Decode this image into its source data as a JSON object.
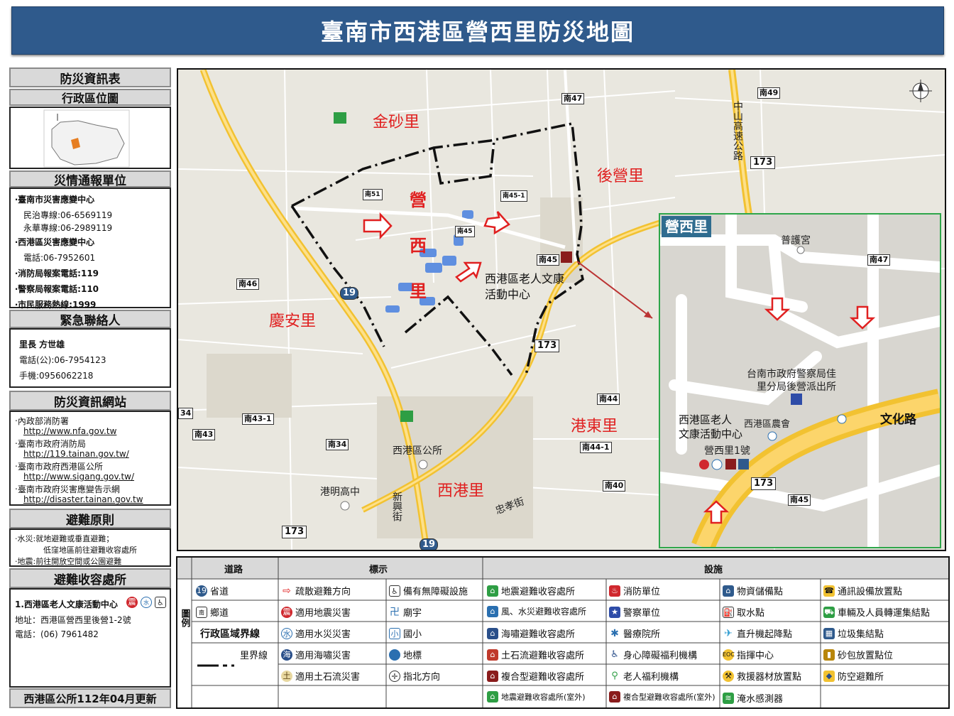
{
  "title": "臺南市西港區營西里防災地圖",
  "side": {
    "info_header": "防災資訊表",
    "location_header": "行政區位圖",
    "report_header": "災情通報單位",
    "report_lines": [
      "‧臺南市災害應變中心",
      "民治專線:06-6569119",
      "永華專線:06-2989119",
      "‧西港區災害應變中心",
      "電話:06-7952601",
      "‧消防局報案電話:119",
      "‧警察局報案電話:110",
      "‧市民服務熱線:1999"
    ],
    "contact_header": "緊急聯絡人",
    "contact_lines": [
      "里長 方世雄",
      "電話(公):06-7954123",
      "手機:0956062218"
    ],
    "web_header": "防災資訊網站",
    "web_lines": [
      {
        "name": "‧內政部消防署",
        "url": "http://www.nfa.gov.tw"
      },
      {
        "name": "‧臺南市政府消防局",
        "url": "http://119.tainan.gov.tw/"
      },
      {
        "name": "‧臺南市政府西港區公所",
        "url": "http://www.sigang.gov.tw/"
      },
      {
        "name": "‧臺南市政府災害應變告示網",
        "url": "http://disaster.tainan.gov.tw"
      }
    ],
    "principle_header": "避難原則",
    "principle_lines": [
      "‧水災:就地避難或垂直避難；",
      "低窪地區前往避難收容處所",
      "‧地震:前往開放空間或公園避難"
    ],
    "shelter_header": "避難收容處所",
    "shelter_name": "1.西港區老人文康活動中心",
    "shelter_addr": "地址：西港區營西里後營1-2號",
    "shelter_tel": "電話：(06) 7961482",
    "footer": "西港區公所112年04月更新"
  },
  "map": {
    "villages": [
      "金砂里",
      "後營里",
      "慶安里",
      "港東里",
      "西港里"
    ],
    "center_village_chars": [
      "營",
      "西",
      "里"
    ],
    "places": [
      "西港區老人文康活動中心",
      "西港區公所",
      "港明高中",
      "新興街",
      "忠孝街",
      "中山高速公路"
    ],
    "roads": [
      "南47",
      "南49",
      "173",
      "南51",
      "南45",
      "南45-1",
      "南46",
      "19",
      "南44",
      "南43-1",
      "南43",
      "南34",
      "南44-1",
      "南40",
      "34"
    ],
    "inset": {
      "title": "營西里",
      "labels": [
        "普護宮",
        "南47",
        "台南市政府警察局佳",
        "里分局後營派出所",
        "西港區老人",
        "文康活動中心",
        "西港區農會",
        "營西里1號",
        "文化路",
        "173",
        "南45"
      ]
    }
  },
  "legend": {
    "col_road": "道路",
    "col_sign": "標示",
    "col_facility": "設施",
    "side_label": "圖例",
    "roads": [
      "省道",
      "鄉道"
    ],
    "boundary_header": "行政區域界線",
    "boundary_item": "里界線",
    "signs": [
      "疏散避難方向",
      "適用地震災害",
      "適用水災災害",
      "適用海嘯災害",
      "適用土石流災害"
    ],
    "signs2": [
      "備有無障礙設施",
      "廟宇",
      "國小",
      "地標",
      "指北方向"
    ],
    "facilities": [
      [
        "地震避難收容處所",
        "消防單位",
        "物資儲備點",
        "通訊設備放置點"
      ],
      [
        "風、水災避難收容處所",
        "警察單位",
        "取水點",
        "車輛及人員轉運集結點"
      ],
      [
        "海嘯避難收容處所",
        "醫療院所",
        "直升機起降點",
        "垃圾集結點"
      ],
      [
        "土石流避難收容處所",
        "身心障礙福利機構",
        "指揮中心",
        "砂包放置點位"
      ],
      [
        "複合型避難收容處所",
        "老人福利機構",
        "救援器材放置點",
        "防空避難所"
      ],
      [
        "地震避難收容處所(室外)",
        "複合型避難收容處所(室外)",
        "淹水感測器",
        ""
      ]
    ]
  }
}
